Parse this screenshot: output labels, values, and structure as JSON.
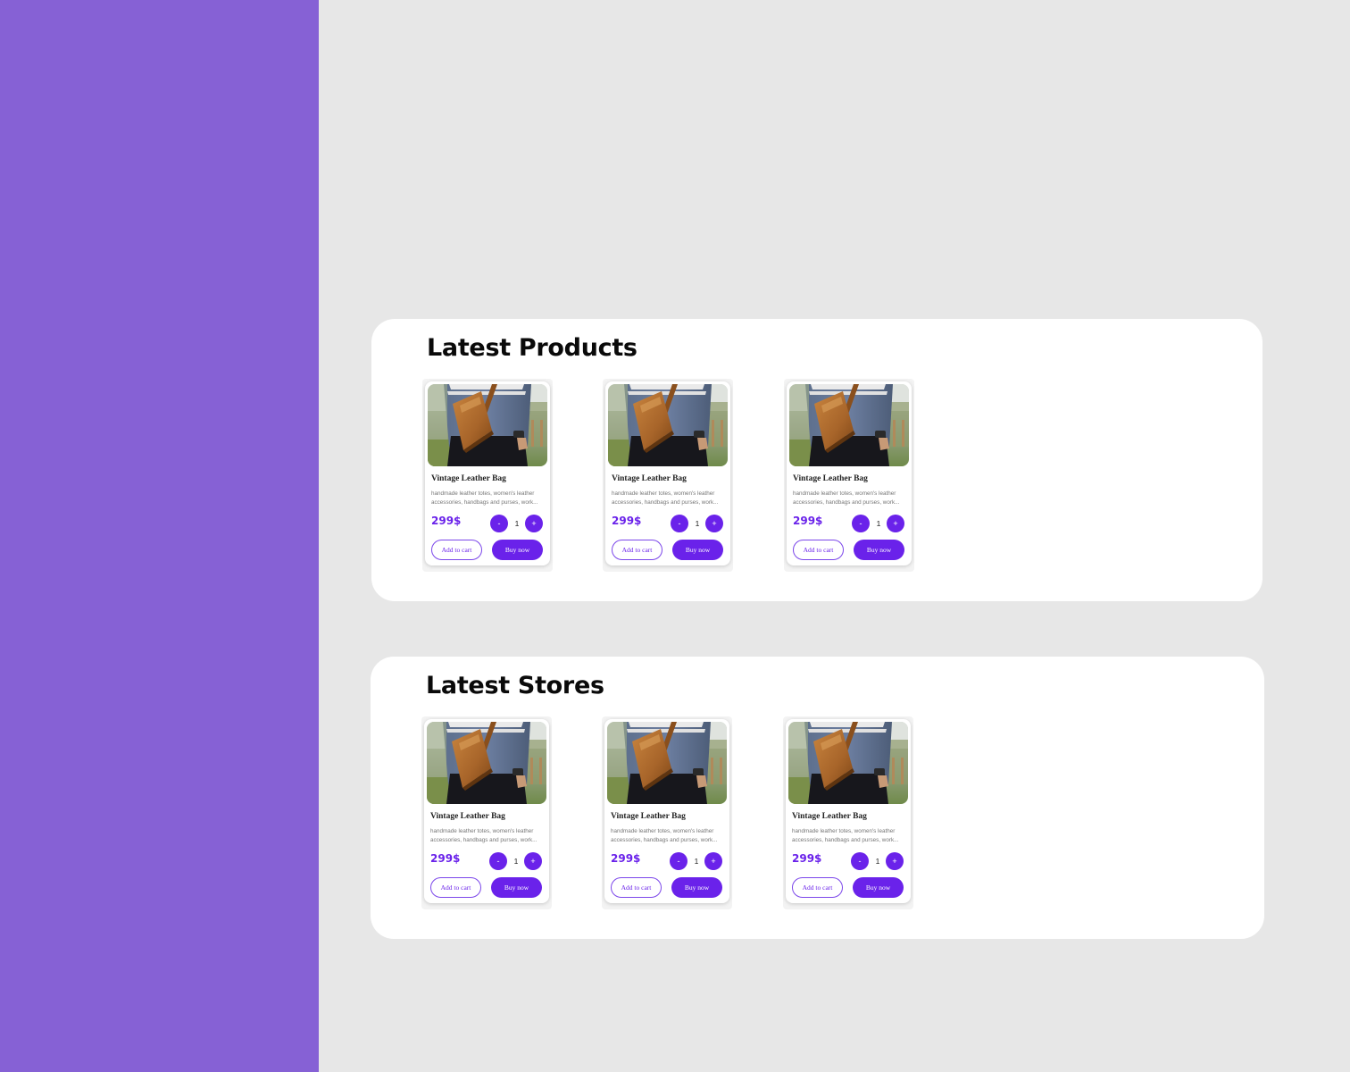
{
  "sections": [
    {
      "title": "Latest Products",
      "cards": [
        {
          "name": "Vintage Leather Bag",
          "desc_line1": "handmade leather totes, women's leather",
          "desc_line2": "accessories, handbags and purses, work...",
          "price": "299$",
          "minus": "-",
          "qty": "1",
          "plus": "+",
          "cart": "Add to cart",
          "buy": "Buy now"
        },
        {
          "name": "Vintage Leather Bag",
          "desc_line1": "handmade leather totes, women's leather",
          "desc_line2": "accessories, handbags and purses, work...",
          "price": "299$",
          "minus": "-",
          "qty": "1",
          "plus": "+",
          "cart": "Add to cart",
          "buy": "Buy now"
        },
        {
          "name": "Vintage Leather Bag",
          "desc_line1": "handmade leather totes, women's leather",
          "desc_line2": "accessories, handbags and purses, work...",
          "price": "299$",
          "minus": "-",
          "qty": "1",
          "plus": "+",
          "cart": "Add to cart",
          "buy": "Buy now"
        }
      ]
    },
    {
      "title": "Latest Stores",
      "cards": [
        {
          "name": "Vintage Leather Bag",
          "desc_line1": "handmade leather totes, women's leather",
          "desc_line2": "accessories, handbags and purses, work...",
          "price": "299$",
          "minus": "-",
          "qty": "1",
          "plus": "+",
          "cart": "Add to cart",
          "buy": "Buy now"
        },
        {
          "name": "Vintage Leather Bag",
          "desc_line1": "handmade leather totes, women's leather",
          "desc_line2": "accessories, handbags and purses, work...",
          "price": "299$",
          "minus": "-",
          "qty": "1",
          "plus": "+",
          "cart": "Add to cart",
          "buy": "Buy now"
        },
        {
          "name": "Vintage Leather Bag",
          "desc_line1": "handmade leather totes, women's leather",
          "desc_line2": "accessories, handbags and purses, work...",
          "price": "299$",
          "minus": "-",
          "qty": "1",
          "plus": "+",
          "cart": "Add to cart",
          "buy": "Buy now"
        }
      ]
    }
  ],
  "colors": {
    "sidebar": "#8661d5",
    "accent": "#6a22ea",
    "background": "#e7e7e7"
  }
}
